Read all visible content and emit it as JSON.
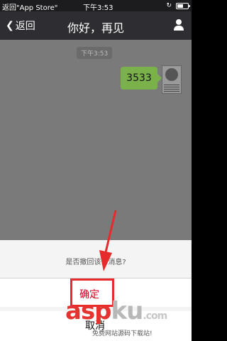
{
  "status_bar": {
    "back_to_app": "返回\"App Store\"",
    "time": "下午3:53",
    "battery_level": 0.6
  },
  "nav": {
    "back_label": "返回",
    "title": "你好，再见",
    "profile_icon": "person-icon"
  },
  "chat": {
    "timestamp": "下午3:53",
    "message": {
      "text": "3533",
      "bubble_color": "#7bb14a"
    }
  },
  "action_sheet": {
    "prompt": "是否撤回该条消息?",
    "confirm_label": "确定",
    "confirm_color": "#d0021b",
    "cancel_label": "取消"
  },
  "watermark": {
    "logo_asp": "asp",
    "logo_ku": "ku",
    "logo_com": ".com",
    "tagline": "免费网站源码下载站!"
  }
}
